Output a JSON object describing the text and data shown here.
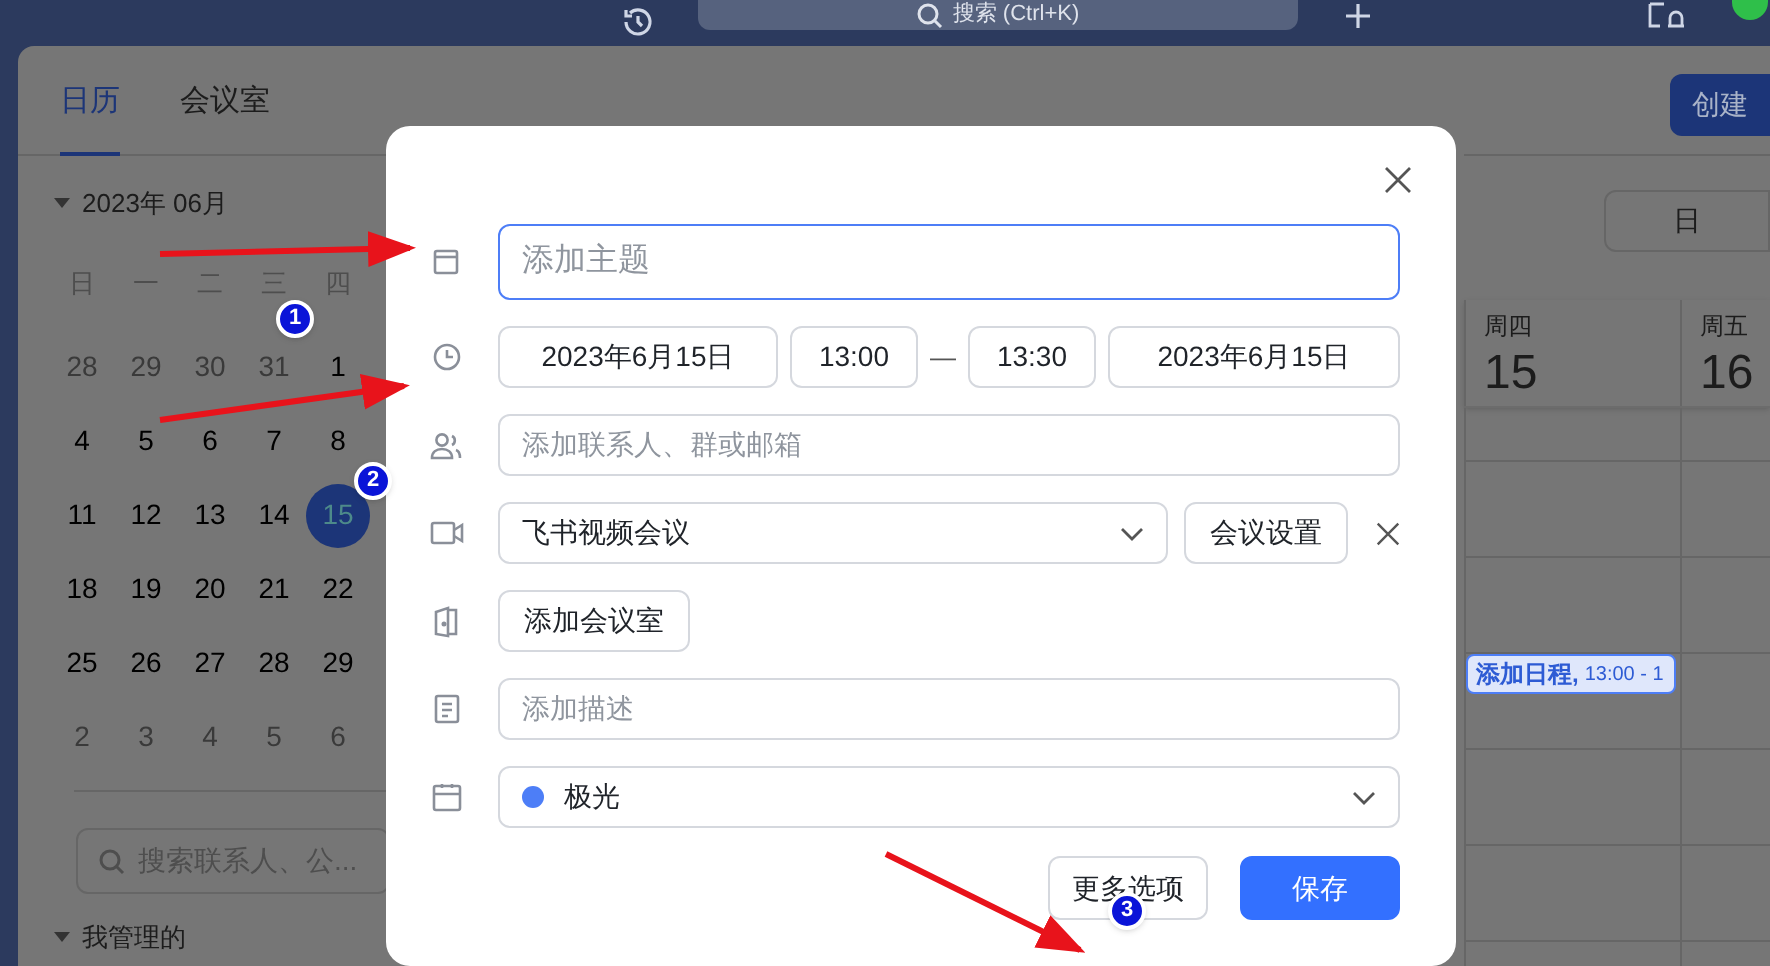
{
  "top_bar": {
    "search_placeholder": "搜索 (Ctrl+K)"
  },
  "tabs": [
    {
      "label": "日历",
      "selected": true
    },
    {
      "label": "会议室",
      "selected": false
    }
  ],
  "mini_calendar": {
    "month": "2023年 06月",
    "weekdays": [
      "日",
      "一",
      "二",
      "三",
      "四"
    ],
    "weeks": [
      [
        {
          "day": "28",
          "muted": true,
          "selected": false
        },
        {
          "day": "29",
          "muted": true,
          "selected": false
        },
        {
          "day": "30",
          "muted": true,
          "selected": false
        },
        {
          "day": "31",
          "muted": true,
          "selected": false
        },
        {
          "day": "1",
          "muted": false,
          "selected": false
        }
      ],
      [
        {
          "day": "4",
          "muted": false,
          "selected": false
        },
        {
          "day": "5",
          "muted": false,
          "selected": false
        },
        {
          "day": "6",
          "muted": false,
          "selected": false
        },
        {
          "day": "7",
          "muted": false,
          "selected": false
        },
        {
          "day": "8",
          "muted": false,
          "selected": false
        }
      ],
      [
        {
          "day": "11",
          "muted": false,
          "selected": false
        },
        {
          "day": "12",
          "muted": false,
          "selected": false
        },
        {
          "day": "13",
          "muted": false,
          "selected": false
        },
        {
          "day": "14",
          "muted": false,
          "selected": false
        },
        {
          "day": "15",
          "muted": false,
          "selected": true
        }
      ],
      [
        {
          "day": "18",
          "muted": false,
          "selected": false
        },
        {
          "day": "19",
          "muted": false,
          "selected": false
        },
        {
          "day": "20",
          "muted": false,
          "selected": false
        },
        {
          "day": "21",
          "muted": false,
          "selected": false
        },
        {
          "day": "22",
          "muted": false,
          "selected": false
        }
      ],
      [
        {
          "day": "25",
          "muted": false,
          "selected": false
        },
        {
          "day": "26",
          "muted": false,
          "selected": false
        },
        {
          "day": "27",
          "muted": false,
          "selected": false
        },
        {
          "day": "28",
          "muted": false,
          "selected": false
        },
        {
          "day": "29",
          "muted": false,
          "selected": false
        }
      ],
      [
        {
          "day": "2",
          "muted": true,
          "selected": false
        },
        {
          "day": "3",
          "muted": true,
          "selected": false
        },
        {
          "day": "4",
          "muted": true,
          "selected": false
        },
        {
          "day": "5",
          "muted": true,
          "selected": false
        },
        {
          "day": "6",
          "muted": true,
          "selected": false
        }
      ]
    ]
  },
  "contact_search": {
    "placeholder": "搜索联系人、公..."
  },
  "section": {
    "label": "我管理的",
    "expanded": true
  },
  "create_button": "创建",
  "view_button": "日",
  "day_columns": [
    {
      "weekday": "周四",
      "date": "15"
    },
    {
      "weekday": "周五",
      "date": "16"
    }
  ],
  "event": {
    "title": "添加日程,",
    "time": "13:00 - 1"
  },
  "dialog": {
    "title_placeholder": "添加主题",
    "start_date": "2023年6月15日",
    "start_time": "13:00",
    "separator": "—",
    "end_time": "13:30",
    "end_date": "2023年6月15日",
    "guests_placeholder": "添加联系人、群或邮箱",
    "meeting_type": "飞书视频会议",
    "meeting_settings": "会议设置",
    "room_button": "添加会议室",
    "description_placeholder": "添加描述",
    "calendar": {
      "name": "极光",
      "color": "#4d7ef7"
    },
    "buttons": [
      {
        "label": "更多选项",
        "kind": "secondary"
      },
      {
        "label": "保存",
        "kind": "primary"
      }
    ]
  },
  "annotations": [
    {
      "number": "1"
    },
    {
      "number": "2"
    },
    {
      "number": "3"
    }
  ]
}
